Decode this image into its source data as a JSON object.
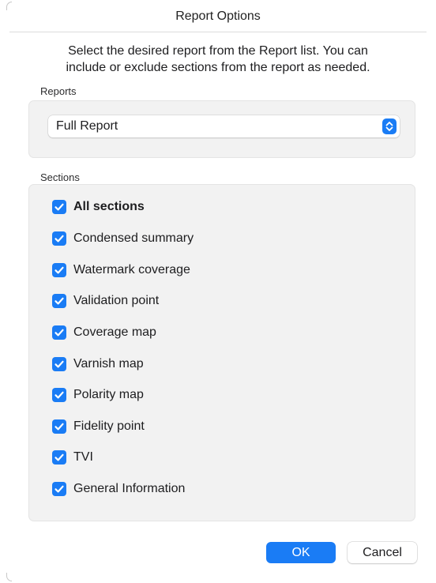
{
  "window": {
    "title": "Report Options"
  },
  "instructions": {
    "line1": "Select the desired report from the Report list. You can",
    "line2": "include or exclude sections from the report as needed."
  },
  "reports": {
    "label": "Reports",
    "selected": "Full Report"
  },
  "sections": {
    "label": "Sections",
    "items": [
      {
        "label": "All sections",
        "checked": true
      },
      {
        "label": "Condensed summary",
        "checked": true
      },
      {
        "label": "Watermark coverage",
        "checked": true
      },
      {
        "label": "Validation point",
        "checked": true
      },
      {
        "label": "Coverage map",
        "checked": true
      },
      {
        "label": "Varnish map",
        "checked": true
      },
      {
        "label": "Polarity map",
        "checked": true
      },
      {
        "label": "Fidelity point",
        "checked": true
      },
      {
        "label": "TVI",
        "checked": true
      },
      {
        "label": "General Information",
        "checked": true
      }
    ]
  },
  "buttons": {
    "ok": "OK",
    "cancel": "Cancel"
  },
  "colors": {
    "accent": "#1a7cf5",
    "panel_background": "#f2f2f2"
  },
  "icons": {
    "checkbox": "checkmark-icon",
    "select": "chevron-up-down-icon"
  }
}
